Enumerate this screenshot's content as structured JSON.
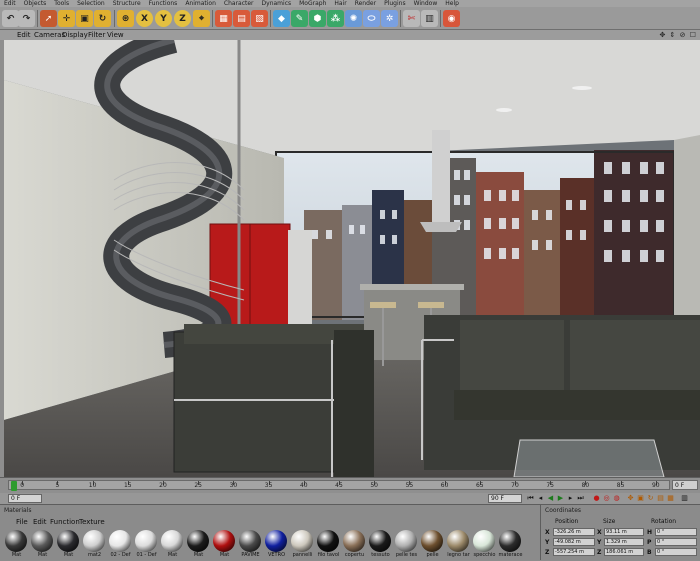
{
  "menu": [
    "Edit",
    "Objects",
    "Tools",
    "Selection",
    "Structure",
    "Functions",
    "Animation",
    "Character",
    "Dynamics",
    "MoGraph",
    "Hair",
    "Render",
    "Plugins",
    "Window",
    "Help"
  ],
  "toolbar": {
    "axis_labels": [
      "X",
      "Y",
      "Z"
    ]
  },
  "viewport_menu": [
    "Edit",
    "Cameras",
    "Display",
    "Filter",
    "View"
  ],
  "viewport_controls": "✥ ⇕ ⊘ ☐",
  "timeline": {
    "ticks": [
      "0",
      "5",
      "10",
      "15",
      "20",
      "25",
      "30",
      "35",
      "40",
      "45",
      "50",
      "55",
      "60",
      "65",
      "70",
      "75",
      "80",
      "85",
      "90"
    ],
    "end_frame": "0 F"
  },
  "transport": {
    "current_frame": "0 F",
    "max_frame": "90 F"
  },
  "materials": {
    "title": "Materials",
    "menu": [
      "File",
      "Edit",
      "Function",
      "Texture"
    ],
    "items": [
      {
        "label": "Mat",
        "color": "#3a3a3a"
      },
      {
        "label": "Mat",
        "color": "#5a5a5a"
      },
      {
        "label": "Mat",
        "color": "#2a2a2e"
      },
      {
        "label": "mat2",
        "color": "#cfcfcf"
      },
      {
        "label": "02 - Def",
        "color": "#e6e6e6"
      },
      {
        "label": "01 - Def",
        "color": "#dcdcdc"
      },
      {
        "label": "Mat",
        "color": "#d8d8d8"
      },
      {
        "label": "Mat",
        "color": "#1c1c1c"
      },
      {
        "label": "Mat",
        "color": "#b01010"
      },
      {
        "label": "PAVIME",
        "color": "#4a4a4a"
      },
      {
        "label": "VETRO",
        "color": "#1020a0"
      },
      {
        "label": "pannelli",
        "color": "#cdc8bd"
      },
      {
        "label": "filo tavol",
        "color": "#111111"
      },
      {
        "label": "copertu",
        "color": "#8a7058"
      },
      {
        "label": "tessuto",
        "color": "#1a1a1a"
      },
      {
        "label": "pelle tes",
        "color": "#b0b0b0"
      },
      {
        "label": "pelle",
        "color": "#6d4f2e"
      },
      {
        "label": "legno tar",
        "color": "#9c8a6a"
      },
      {
        "label": "specchio",
        "color": "#d8e6d8"
      },
      {
        "label": "materace",
        "color": "#2c2c2c"
      }
    ]
  },
  "coordinates": {
    "title": "Coordinates",
    "headers": [
      "Position",
      "Size",
      "Rotation"
    ],
    "rows": [
      {
        "axis": "X",
        "position": "-326.26 m",
        "size_axis": "X",
        "size": "93.11 m",
        "rot_axis": "H",
        "rotation": "0 °"
      },
      {
        "axis": "Y",
        "position": "-49.082 m",
        "size_axis": "Y",
        "size": "1.329 m",
        "rot_axis": "P",
        "rotation": "0 °"
      },
      {
        "axis": "Z",
        "position": "-557.254 m",
        "size_axis": "Z",
        "size": "186.061 m",
        "rot_axis": "B",
        "rotation": "0 °"
      }
    ]
  }
}
